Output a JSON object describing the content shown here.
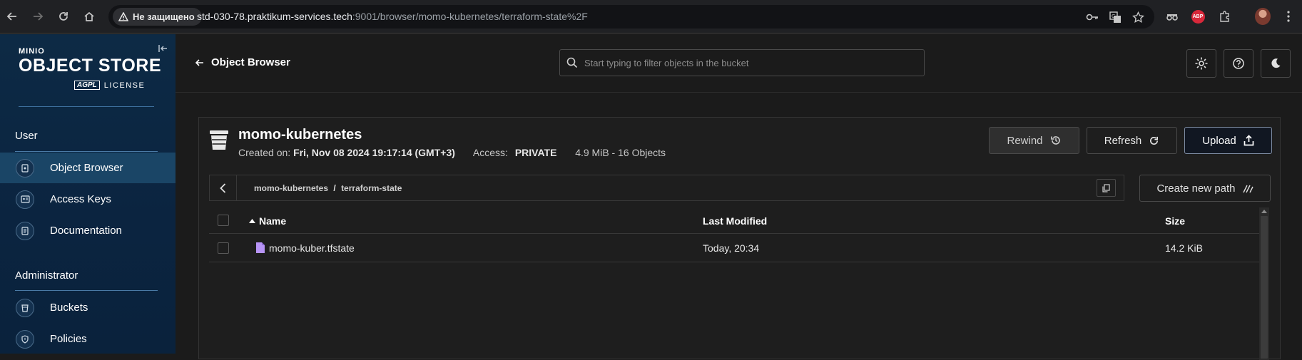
{
  "browser": {
    "security_label": "Не защищено",
    "url_host": "std-030-78.praktikum-services.tech",
    "url_path": ":9001/browser/momo-kubernetes/terraform-state%2F"
  },
  "brand": {
    "minio_text": "MINIO",
    "title": "OBJECT STORE",
    "agpl": "AGPL",
    "license": "LICENSE"
  },
  "sidebar": {
    "sections": [
      {
        "label": "User",
        "items": [
          {
            "label": "Object Browser",
            "icon": "object-browser-icon",
            "active": true
          },
          {
            "label": "Access Keys",
            "icon": "access-keys-icon",
            "active": false
          },
          {
            "label": "Documentation",
            "icon": "documentation-icon",
            "active": false
          }
        ]
      },
      {
        "label": "Administrator",
        "items": [
          {
            "label": "Buckets",
            "icon": "buckets-icon",
            "active": false
          },
          {
            "label": "Policies",
            "icon": "policies-icon",
            "active": false
          }
        ]
      }
    ]
  },
  "topbar": {
    "back_label": "Object Browser",
    "search_placeholder": "Start typing to filter objects in the bucket"
  },
  "bucket": {
    "name": "momo-kubernetes",
    "created_label": "Created on:",
    "created_value": "Fri, Nov 08 2024 19:17:14 (GMT+3)",
    "access_label": "Access:",
    "access_value": "PRIVATE",
    "usage": "4.9 MiB - 16 Objects",
    "rewind_label": "Rewind",
    "refresh_label": "Refresh",
    "upload_label": "Upload",
    "create_path_label": "Create new path"
  },
  "breadcrumb": {
    "parts": [
      "momo-kubernetes",
      "terraform-state"
    ],
    "separator": "/"
  },
  "table": {
    "columns": {
      "name": "Name",
      "modified": "Last Modified",
      "size": "Size"
    },
    "sort": {
      "column": "name",
      "direction": "asc"
    },
    "rows": [
      {
        "name": "momo-kuber.tfstate",
        "modified": "Today, 20:34",
        "size": "14.2 KiB"
      }
    ]
  },
  "colors": {
    "sidebar_bg": "#0b2440",
    "sidebar_active": "#1a4566",
    "file_icon": "#b794f6",
    "upload_border": "#7e8ca3"
  }
}
